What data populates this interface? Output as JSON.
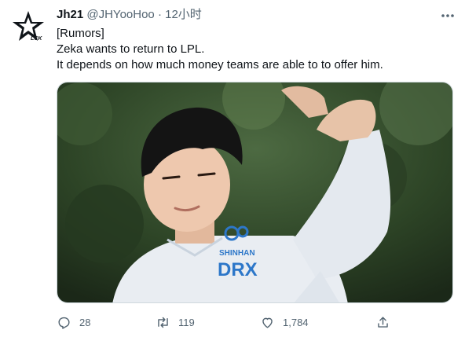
{
  "author": {
    "display_name": "Jh21",
    "handle": "@JHYooHoo",
    "separator": "·",
    "time": "12小时",
    "avatar_text": "LCK"
  },
  "tweet": {
    "lines": [
      "[Rumors]",
      "Zeka wants to return to LPL.",
      "It depends on how much money teams are able to to offer him."
    ]
  },
  "media": {
    "jersey_text_1": "SHINHAN",
    "jersey_text_2": "DRX"
  },
  "actions": {
    "reply": {
      "icon": "reply-icon",
      "count": "28"
    },
    "retweet": {
      "icon": "retweet-icon",
      "count": "119"
    },
    "like": {
      "icon": "like-icon",
      "count": "1,784"
    },
    "share": {
      "icon": "share-icon"
    }
  },
  "colors": {
    "text": "#0f1419",
    "muted": "#536471",
    "border": "#cfd9de",
    "jersey_blue": "#2d77c9"
  }
}
